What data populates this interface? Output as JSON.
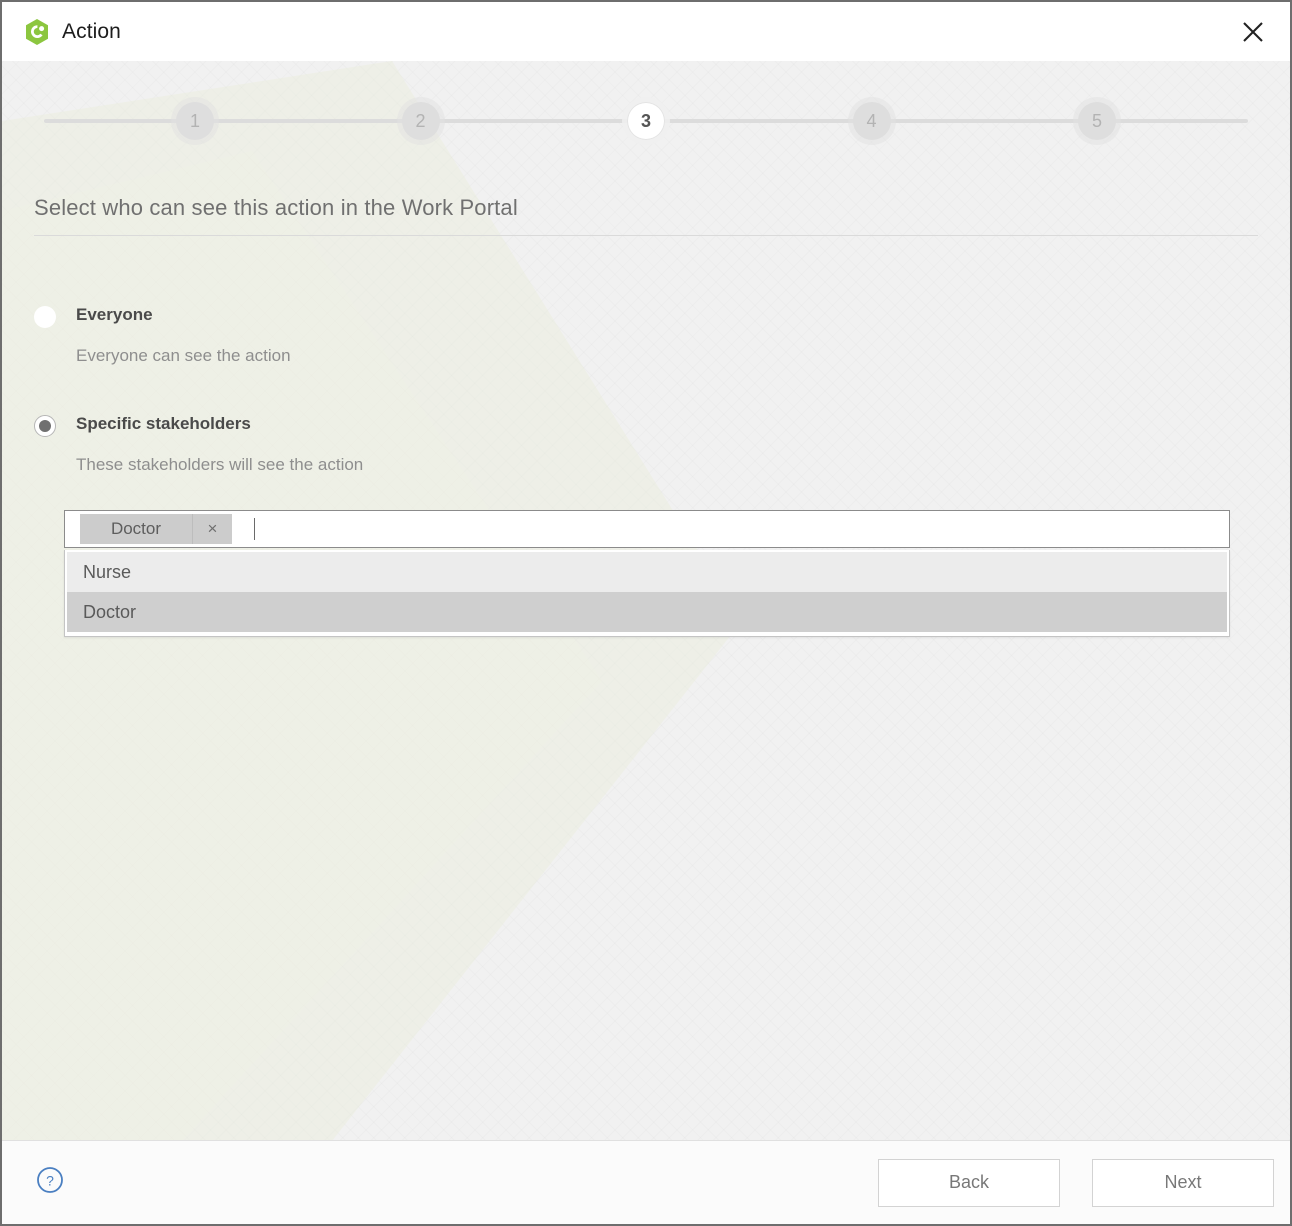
{
  "window": {
    "title": "Action",
    "logo_icon": "green-hexagon-logo",
    "close_icon": "close-icon"
  },
  "stepper": {
    "steps": [
      {
        "number": "1",
        "state": "muted"
      },
      {
        "number": "2",
        "state": "muted"
      },
      {
        "number": "3",
        "state": "active"
      },
      {
        "number": "4",
        "state": "muted"
      },
      {
        "number": "5",
        "state": "muted"
      }
    ],
    "current": "3"
  },
  "main": {
    "heading": "Select who can see this action in the Work Portal",
    "options": [
      {
        "label": "Everyone",
        "description": "Everyone can see the action",
        "selected": false
      },
      {
        "label": "Specific stakeholders",
        "description": "These stakeholders will see the action",
        "selected": true
      }
    ],
    "stakeholder_select": {
      "placeholder": "",
      "value": "",
      "chips": [
        {
          "label": "Doctor",
          "remove_icon": "close-icon",
          "remove_glyph": "×"
        }
      ],
      "dropdown_open": true,
      "dropdown_options": [
        {
          "label": "Nurse",
          "highlighted": false
        },
        {
          "label": "Doctor",
          "highlighted": true
        }
      ]
    }
  },
  "footer": {
    "help_icon": "help-circle-icon",
    "help_glyph": "?",
    "back_label": "Back",
    "next_label": "Next"
  },
  "colors": {
    "brand_green": "#8cc63f",
    "body_background": "#f1f1f1",
    "accent_blue": "#4a7fc1",
    "active_step_text": "#555555",
    "chip_background": "#cccccc",
    "dropdown_highlight": "#cfcfcf"
  }
}
